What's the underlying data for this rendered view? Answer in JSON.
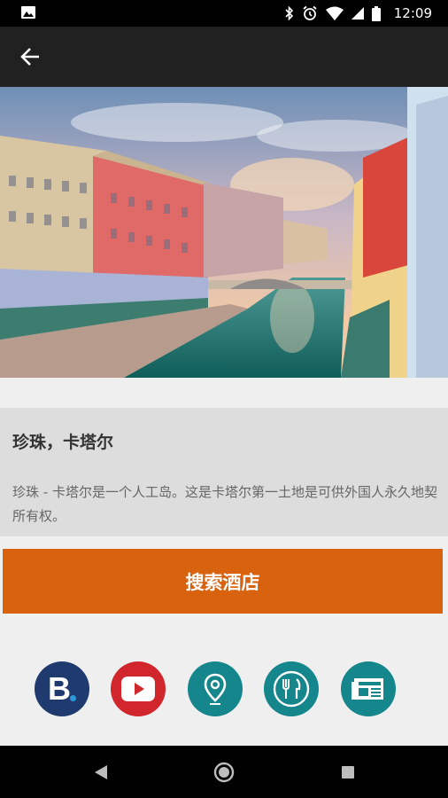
{
  "status_bar": {
    "time": "12:09",
    "icons": [
      "image-icon",
      "bluetooth-icon",
      "alarm-icon",
      "wifi-icon",
      "signal-icon",
      "battery-icon"
    ]
  },
  "app_bar": {
    "back_icon": "arrow-left-icon"
  },
  "place": {
    "title": "珍珠，卡塔尔",
    "description": "珍珠 - 卡塔尔是一个人工岛。这是卡塔尔第一土地是可供外国人永久地契所有权。"
  },
  "search_hotels_label": "搜索酒店",
  "quick_links": [
    {
      "icon": "booking-icon",
      "letter": "B",
      "color": "#1f3a6e"
    },
    {
      "icon": "youtube-icon",
      "color": "#d1262c"
    },
    {
      "icon": "map-pin-icon",
      "color": "#14868c"
    },
    {
      "icon": "restaurant-icon",
      "color": "#14868c"
    },
    {
      "icon": "newspaper-icon",
      "color": "#14868c"
    }
  ],
  "colors": {
    "accent": "#d9620f",
    "app_bar": "#212121",
    "teal": "#14868c"
  }
}
